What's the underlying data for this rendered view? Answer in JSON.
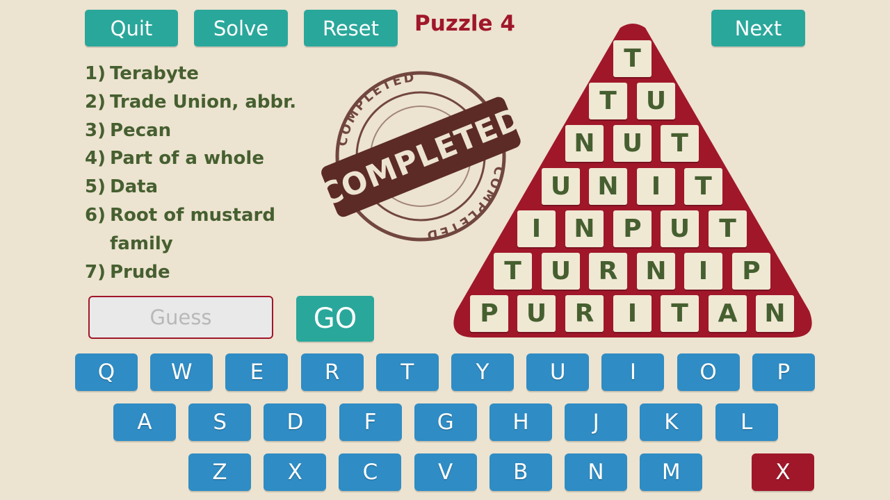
{
  "toolbar": {
    "quit_label": "Quit",
    "solve_label": "Solve",
    "reset_label": "Reset",
    "next_label": "Next"
  },
  "puzzle_title": "Puzzle 4",
  "clues": [
    {
      "num": "1)",
      "text": "Terabyte"
    },
    {
      "num": "2)",
      "text": "Trade Union, abbr."
    },
    {
      "num": "3)",
      "text": "Pecan"
    },
    {
      "num": "4)",
      "text": "Part of a whole"
    },
    {
      "num": "5)",
      "text": "Data"
    },
    {
      "num": "6)",
      "text": "Root of mustard family"
    },
    {
      "num": "7)",
      "text": "Prude"
    }
  ],
  "guess": {
    "placeholder": "Guess",
    "value": ""
  },
  "go_label": "GO",
  "stamp": {
    "big": "COMPLETED",
    "ring": "COMPLETED"
  },
  "pyramid": {
    "rows": [
      "T",
      "TU",
      "NUT",
      "UNIT",
      "INPUT",
      "TURNIP",
      "PURITAN"
    ],
    "color": "#a0172a"
  },
  "keyboard": {
    "rows": [
      [
        "Q",
        "W",
        "E",
        "R",
        "T",
        "Y",
        "U",
        "I",
        "O",
        "P"
      ],
      [
        "A",
        "S",
        "D",
        "F",
        "G",
        "H",
        "J",
        "K",
        "L"
      ],
      [
        "Z",
        "X",
        "C",
        "V",
        "B",
        "N",
        "M"
      ]
    ],
    "delete_label": "X"
  },
  "colors": {
    "teal": "#2aa79b",
    "key_blue": "#2f8cc4",
    "red": "#a0172a",
    "clue_green": "#465f30",
    "background": "#ece3d0"
  }
}
